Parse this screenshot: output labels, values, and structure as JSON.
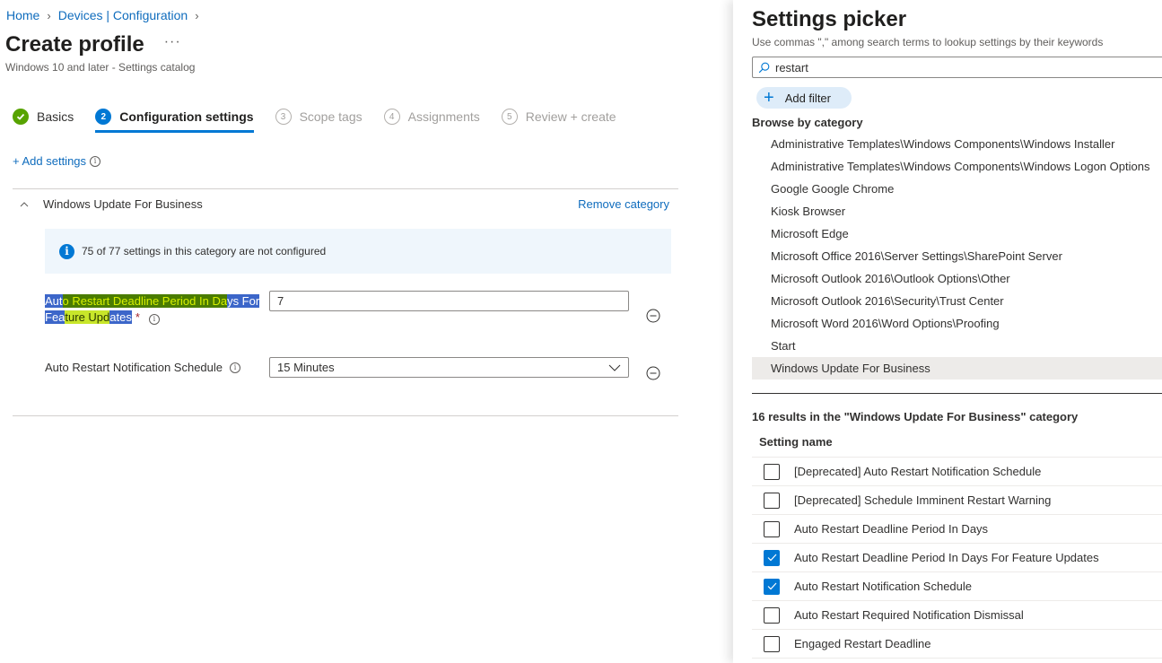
{
  "breadcrumb": {
    "items": [
      "Home",
      "Devices | Configuration"
    ]
  },
  "page": {
    "title": "Create profile",
    "more_label": "···",
    "subtitle": "Windows 10 and later - Settings catalog"
  },
  "wizard": {
    "steps": [
      {
        "number": "✓",
        "label": "Basics",
        "state": "done"
      },
      {
        "number": "2",
        "label": "Configuration settings",
        "state": "active"
      },
      {
        "number": "3",
        "label": "Scope tags",
        "state": "todo"
      },
      {
        "number": "4",
        "label": "Assignments",
        "state": "todo"
      },
      {
        "number": "5",
        "label": "Review + create",
        "state": "todo"
      }
    ]
  },
  "add_settings": {
    "label": "+ Add settings",
    "info_glyph": "i"
  },
  "category": {
    "name": "Windows Update For Business",
    "remove_label": "Remove category",
    "info_text": "75 of 77 settings in this category are not configured",
    "info_glyph": "i",
    "settings": [
      {
        "label_parts": [
          "Aut",
          "o ",
          "Restart Deadline Period In Da",
          "ys For",
          "Fea",
          "ture Upd",
          "ates"
        ],
        "required_mark": "*",
        "value": "7",
        "control": "text"
      },
      {
        "label": "Auto Restart Notification Schedule",
        "value": "15 Minutes",
        "control": "dropdown"
      }
    ]
  },
  "picker": {
    "title": "Settings picker",
    "subtitle": "Use commas \",\" among search terms to lookup settings by their keywords",
    "search_value": "restart",
    "add_filter_label": "Add filter",
    "add_filter_glyph": "+",
    "browse_heading": "Browse by category",
    "categories": [
      "Administrative Templates\\Windows Components\\Windows Installer",
      "Administrative Templates\\Windows Components\\Windows Logon Options",
      "Google Google Chrome",
      "Kiosk Browser",
      "Microsoft Edge",
      "Microsoft Office 2016\\Server Settings\\SharePoint Server",
      "Microsoft Outlook 2016\\Outlook Options\\Other",
      "Microsoft Outlook 2016\\Security\\Trust Center",
      "Microsoft Word 2016\\Word Options\\Proofing",
      "Start",
      "Windows Update For Business"
    ],
    "selected_category": "Windows Update For Business",
    "results_heading": "16 results in the \"Windows Update For Business\" category",
    "column_header": "Setting name",
    "results": [
      {
        "name": "[Deprecated] Auto Restart Notification Schedule",
        "checked": false
      },
      {
        "name": "[Deprecated] Schedule Imminent Restart Warning",
        "checked": false
      },
      {
        "name": "Auto Restart Deadline Period In Days",
        "checked": false
      },
      {
        "name": "Auto Restart Deadline Period In Days For Feature Updates",
        "checked": true
      },
      {
        "name": "Auto Restart Notification Schedule",
        "checked": true
      },
      {
        "name": "Auto Restart Required Notification Dismissal",
        "checked": false
      },
      {
        "name": "Engaged Restart Deadline",
        "checked": false
      }
    ]
  },
  "colors": {
    "accent": "#0078d4",
    "link": "#0f6cbd",
    "success": "#57a300",
    "info_banner_bg": "#eff6fc",
    "selection_highlight": "#3c66c9",
    "search_highlight": "#c8e62a"
  }
}
